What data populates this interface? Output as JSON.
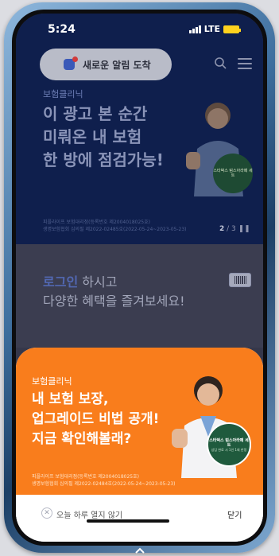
{
  "status_bar": {
    "time": "5:24",
    "network": "LTE"
  },
  "header": {
    "notice": "새로운 알림 도착"
  },
  "hero": {
    "tag": "보험클리닉",
    "title_lines": [
      "이 광고 본 순간",
      "미뤄온 내 보험",
      "한 방에 점검가능!"
    ],
    "legal_lines": [
      "피플라이프 보험대리점(등록번호 제2004018025호)",
      "생명보험협회 심의필 제2022-02485호(2022-05-24~2023-05-23)"
    ],
    "pager_current": "2",
    "pager_total": "/ 3",
    "badge": "스타벅스 텀스아라떼 세트"
  },
  "login": {
    "accent": "로그인",
    "rest": " 하시고",
    "line2": "다양한 혜택을 즐겨보세요!"
  },
  "sheet": {
    "tag": "보험클리닉",
    "title_lines": [
      "내 보험 보장,",
      "업그레이드 비법 공개!",
      "지금 확인해볼래?"
    ],
    "legal_lines": [
      "피플라이프 보험대리점(등록번호 제2004018025호)",
      "생명보험협회 심의필 제2022-02484호(2022-05-24~2023-05-23)"
    ],
    "badge_title": "스타벅스 텀스아라떼 세트",
    "badge_sub": "상담 완료 시 1인 1회 한정",
    "dont_show_label": "오늘 하루 열지 않기",
    "close_label": "닫기"
  },
  "colors": {
    "brand_orange": "#f97d1c",
    "brand_navy": "#0f1f4d",
    "accent_blue": "#3a59b8"
  }
}
